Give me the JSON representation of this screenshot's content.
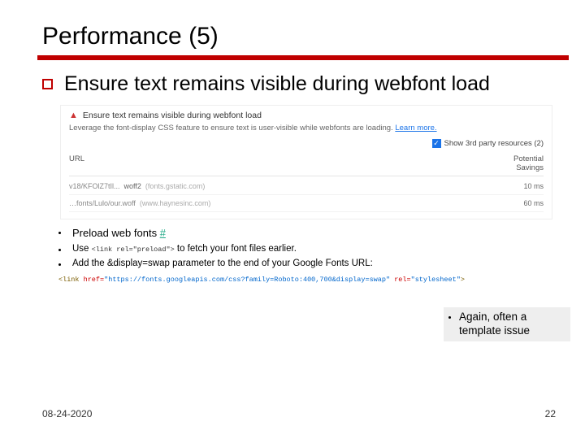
{
  "title": "Performance (5)",
  "main_bullet": "Ensure text remains visible during webfont load",
  "audit": {
    "heading": "Ensure text remains visible during webfont load",
    "description_pre": "Leverage the font-display CSS feature to ensure text is user-visible while webfonts are loading. ",
    "learn_more": "Learn more.",
    "third_party_label": "Show 3rd party resources (2)",
    "col_url": "URL",
    "col_savings_1": "Potential",
    "col_savings_2": "Savings",
    "rows": [
      {
        "path": "v18/KFOlZ7tIl...",
        "ext": "woff2",
        "host": "(fonts.gstatic.com)",
        "savings": "10 ms"
      },
      {
        "path": "…fonts/Lulo/our.woff",
        "ext": "",
        "host": "(www.haynesinc.com)",
        "savings": "60 ms"
      }
    ]
  },
  "bullets": {
    "preload": "Preload web fonts ",
    "preload_hash": "#",
    "use_pre": "Use ",
    "use_code": "<link rel=\"preload\">",
    "use_post": " to fetch your font files earlier.",
    "add_param": "Add the &display=swap parameter to the end of your Google Fonts URL:"
  },
  "code_example": {
    "open": "<link ",
    "href_attr": "href=",
    "href_val": "\"https://fonts.googleapis.com/css?family=Roboto:400,700&display=swap\" ",
    "rel_attr": "rel=",
    "rel_val": "\"stylesheet\"",
    "close": ">"
  },
  "callout": "Again, often a template issue",
  "footer": {
    "date": "08-24-2020",
    "page": "22"
  }
}
